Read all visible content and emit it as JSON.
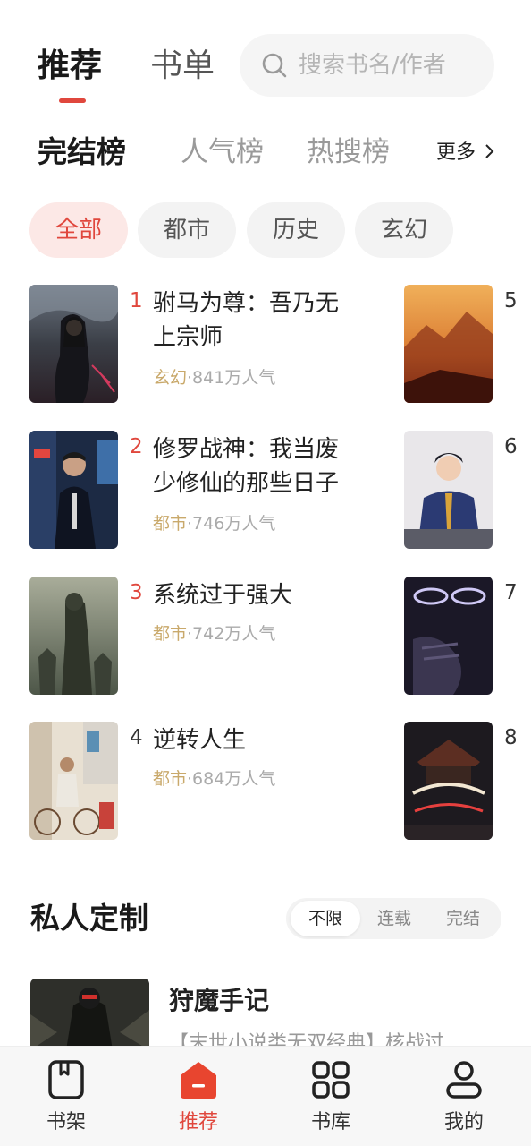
{
  "header": {
    "tabs": [
      {
        "label": "推荐",
        "active": true
      },
      {
        "label": "书单",
        "active": false
      }
    ],
    "search": {
      "placeholder": "搜索书名/作者",
      "icon": "search-icon"
    },
    "accent_color": "#e0473d"
  },
  "rank_tabs": {
    "items": [
      {
        "label": "完结榜",
        "active": true
      },
      {
        "label": "人气榜",
        "active": false
      },
      {
        "label": "热搜榜",
        "active": false
      }
    ],
    "more_label": "更多",
    "more_icon": "chevron-right-icon"
  },
  "categories": [
    {
      "label": "全部",
      "active": true
    },
    {
      "label": "都市",
      "active": false
    },
    {
      "label": "历史",
      "active": false
    },
    {
      "label": "玄幻",
      "active": false
    }
  ],
  "ranking": {
    "left": [
      {
        "rank": "1",
        "title": "驸马为尊：吾乃无上宗师",
        "category": "玄幻",
        "popularity": "·841万人气"
      },
      {
        "rank": "2",
        "title": "修罗战神：我当废少修仙的那些日子",
        "category": "都市",
        "popularity": "·746万人气"
      },
      {
        "rank": "3",
        "title": "系统过于强大",
        "category": "都市",
        "popularity": "·742万人气"
      },
      {
        "rank": "4",
        "title": "逆转人生",
        "category": "都市",
        "popularity": "·684万人气"
      }
    ],
    "right": [
      {
        "rank": "5"
      },
      {
        "rank": "6"
      },
      {
        "rank": "7"
      },
      {
        "rank": "8"
      }
    ]
  },
  "custom_section": {
    "title": "私人定制",
    "filters": [
      {
        "label": "不限",
        "active": true
      },
      {
        "label": "连载",
        "active": false
      },
      {
        "label": "完结",
        "active": false
      }
    ],
    "book": {
      "title": "狩魔手记",
      "description": "【末世小说类无双经典】核战过"
    }
  },
  "bottom_nav": [
    {
      "label": "书架",
      "icon": "bookshelf-icon",
      "active": false
    },
    {
      "label": "推荐",
      "icon": "home-icon",
      "active": true
    },
    {
      "label": "书库",
      "icon": "library-grid-icon",
      "active": false
    },
    {
      "label": "我的",
      "icon": "profile-icon",
      "active": false
    }
  ]
}
